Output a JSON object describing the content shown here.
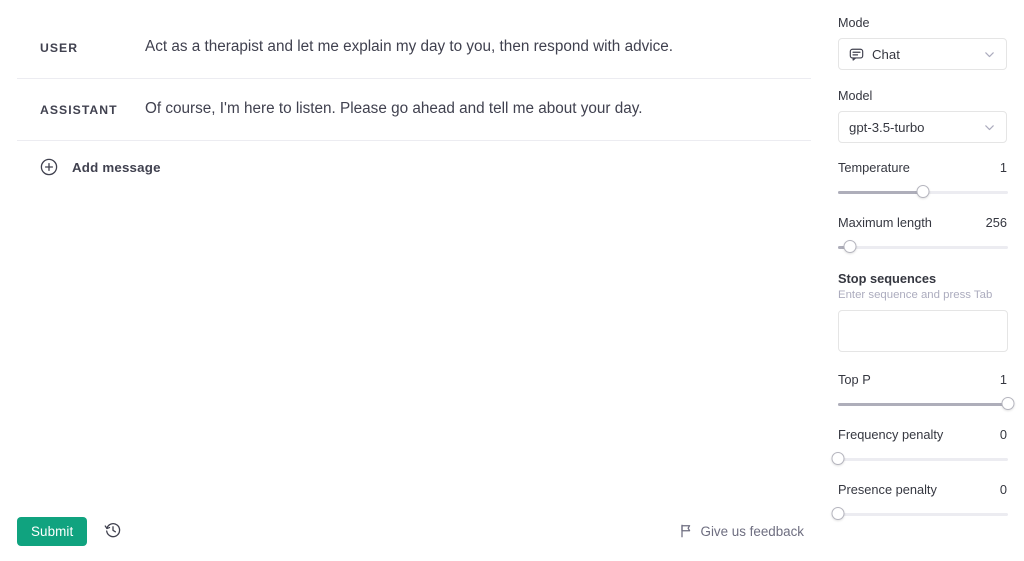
{
  "conversation": {
    "messages": [
      {
        "role": "USER",
        "text": "Act as a therapist and let me explain my day to you, then respond with advice."
      },
      {
        "role": "ASSISTANT",
        "text": "Of course, I'm here to listen. Please go ahead and tell me about your day."
      }
    ],
    "add_message_label": "Add message",
    "add_message_icon": "plus-circle-icon"
  },
  "bottom_bar": {
    "submit_label": "Submit",
    "submit_color": "#10a37f",
    "history_icon": "history-icon",
    "feedback_label": "Give us feedback",
    "feedback_icon": "flag-icon"
  },
  "sidebar": {
    "mode": {
      "label": "Mode",
      "value": "Chat",
      "icon": "chat-bubble-icon",
      "chevron_icon": "chevron-down-icon"
    },
    "model": {
      "label": "Model",
      "value": "gpt-3.5-turbo",
      "chevron_icon": "chevron-down-icon"
    },
    "sliders": [
      {
        "label": "Temperature",
        "value": "1",
        "percent": 50
      },
      {
        "label": "Maximum length",
        "value": "256",
        "percent": 7
      },
      {
        "label": "Top P",
        "value": "1",
        "percent": 100
      },
      {
        "label": "Frequency penalty",
        "value": "0",
        "percent": 0
      },
      {
        "label": "Presence penalty",
        "value": "0",
        "percent": 0
      }
    ],
    "stop_sequences": {
      "title": "Stop sequences",
      "subtitle": "Enter sequence and press Tab",
      "value": "",
      "placeholder": ""
    }
  }
}
